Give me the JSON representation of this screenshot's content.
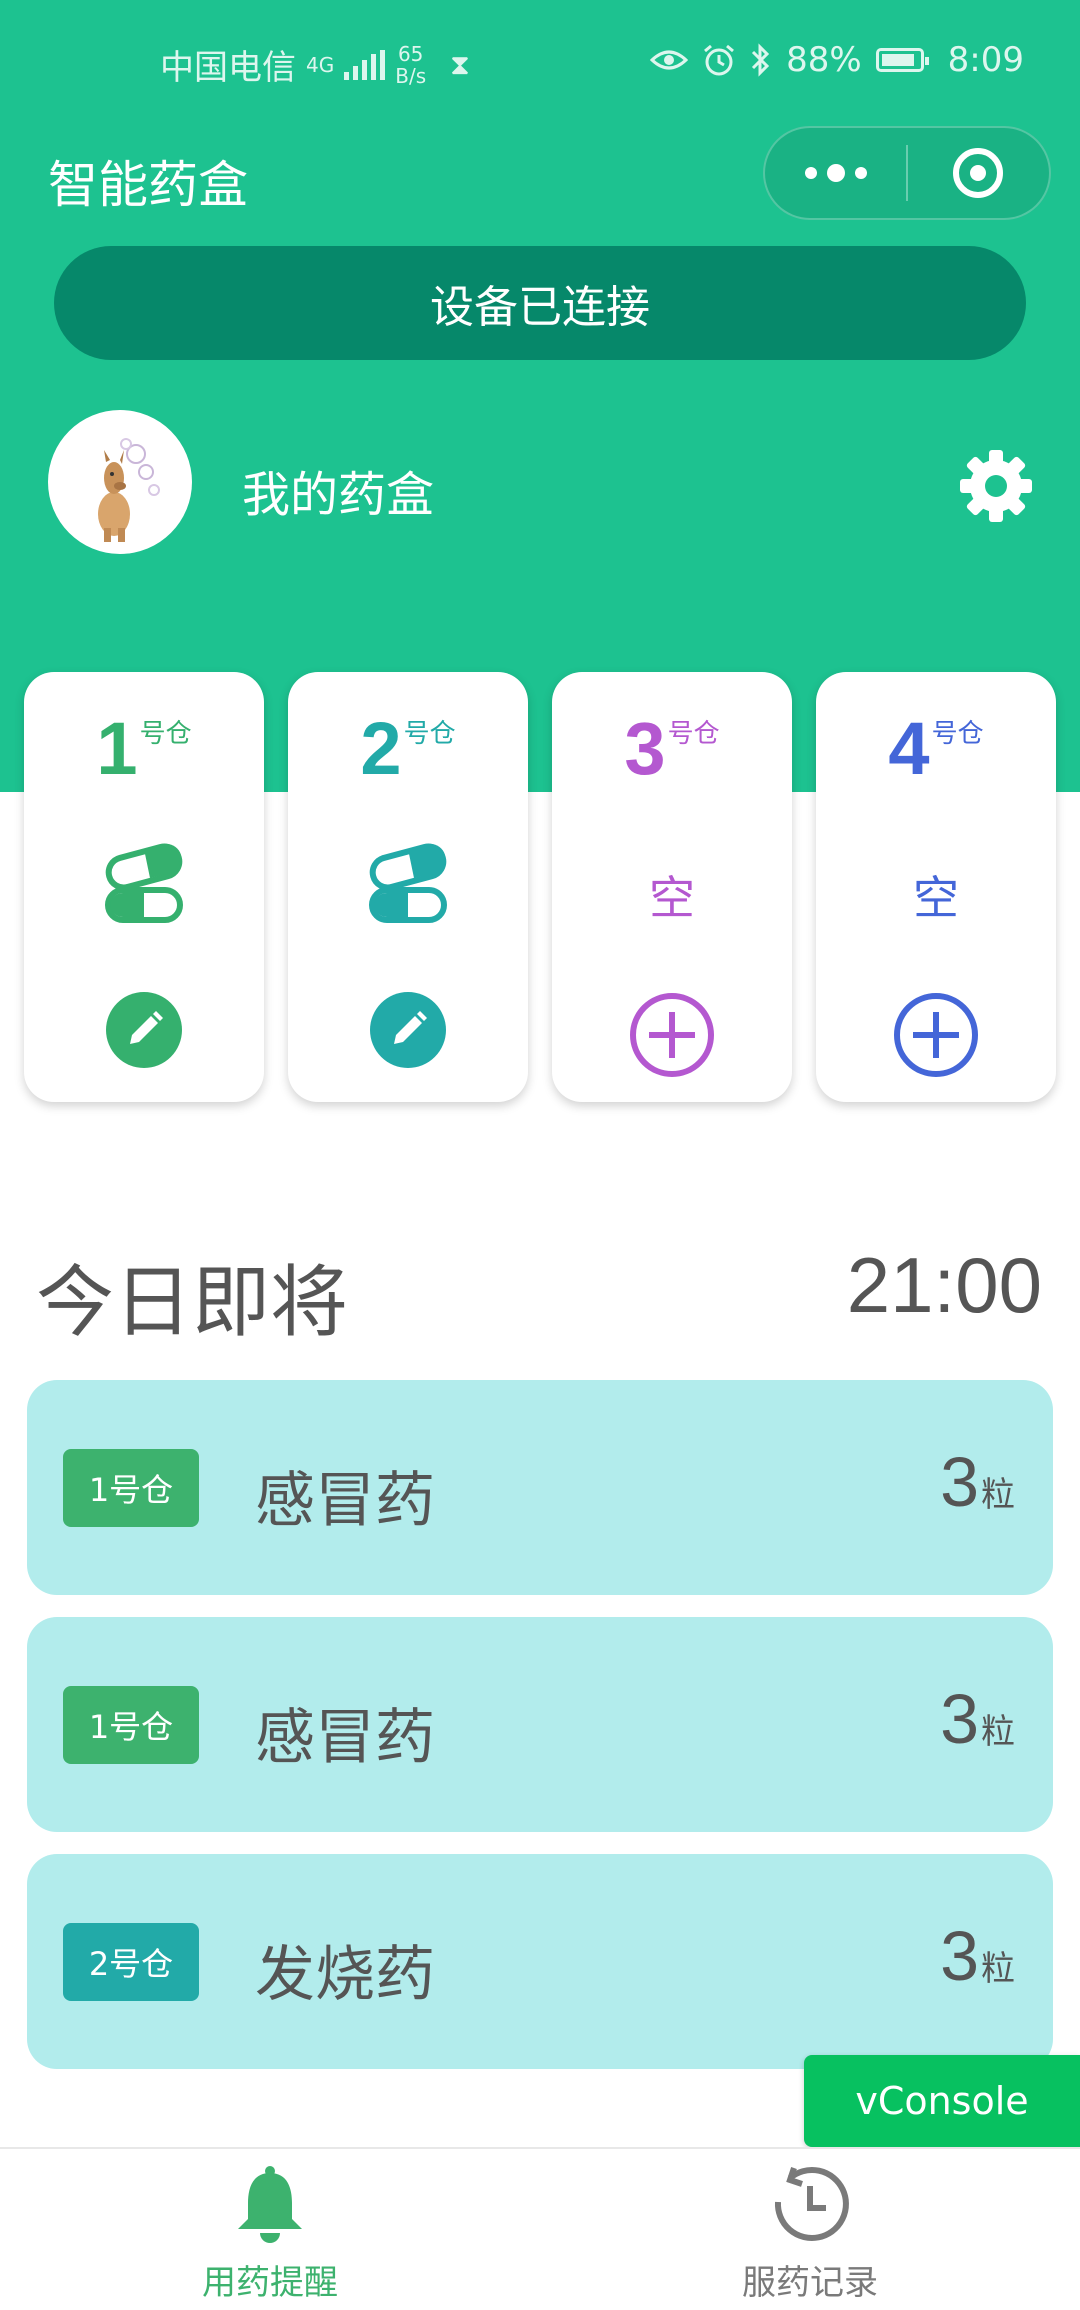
{
  "status_bar": {
    "carrier": "中国电信",
    "network": "4G",
    "speed_value": "65",
    "speed_unit": "B/s",
    "battery": "88%",
    "battery_level": 0.88,
    "time": "8:09"
  },
  "header": {
    "app_title": "智能药盒",
    "connection_button": "设备已连接",
    "box_name": "我的药盒"
  },
  "bins": [
    {
      "number": "1",
      "suffix": "号仓",
      "status": "filled",
      "empty_label": "",
      "color": "#35b06e"
    },
    {
      "number": "2",
      "suffix": "号仓",
      "status": "filled",
      "empty_label": "",
      "color": "#22aaa8"
    },
    {
      "number": "3",
      "suffix": "号仓",
      "status": "empty",
      "empty_label": "空",
      "color": "#b458d0"
    },
    {
      "number": "4",
      "suffix": "号仓",
      "status": "empty",
      "empty_label": "空",
      "color": "#4466d8"
    }
  ],
  "today": {
    "title": "今日即将",
    "time": "21:00",
    "doses": [
      {
        "bin": "1号仓",
        "bin_color": "#3db26e",
        "name": "感冒药",
        "qty": "3",
        "unit": "粒"
      },
      {
        "bin": "1号仓",
        "bin_color": "#3db26e",
        "name": "感冒药",
        "qty": "3",
        "unit": "粒"
      },
      {
        "bin": "2号仓",
        "bin_color": "#22aaa8",
        "name": "发烧药",
        "qty": "3",
        "unit": "粒"
      }
    ]
  },
  "vconsole_label": "vConsole",
  "tabbar": {
    "tabs": [
      {
        "label": "用药提醒",
        "icon": "bell-icon",
        "active": true,
        "color": "#3db26e"
      },
      {
        "label": "服药记录",
        "icon": "history-clock-icon",
        "active": false,
        "color": "#7a7a7a"
      }
    ]
  }
}
